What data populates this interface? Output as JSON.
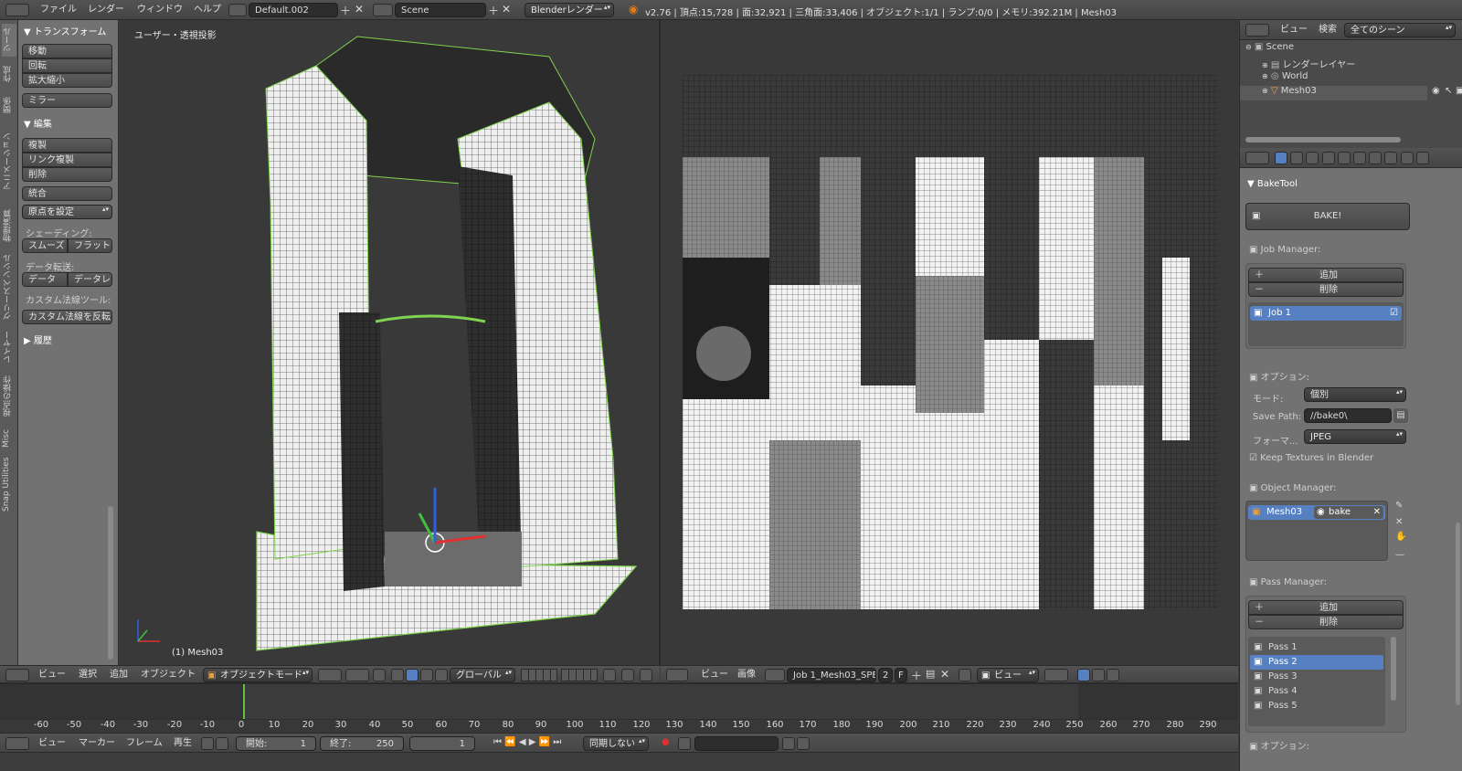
{
  "topbar": {
    "menus": [
      "ファイル",
      "レンダー",
      "ウィンドウ",
      "ヘルプ"
    ],
    "screen_layout": "Default.002",
    "scene": "Scene",
    "render_engine": "Blenderレンダー",
    "stats": "v2.76 | 頂点:15,728 | 面:32,921 | 三角面:33,406 | オブジェクト:1/1 | ランプ:0/0 | メモリ:392.21M | Mesh03"
  },
  "toolshelf": {
    "tabs": [
      "ツール",
      "作成",
      "関係",
      "アニメーション",
      "物理演算",
      "グリースペンシル",
      "レイヤー",
      "視点の操作",
      "Misc",
      "Snap Utilities"
    ],
    "transform_header": "トランスフォーム",
    "transform_buttons": [
      "移動",
      "回転",
      "拡大縮小"
    ],
    "mirror": "ミラー",
    "edit_header": "編集",
    "edit_buttons": [
      "複製",
      "リンク複製",
      "削除"
    ],
    "join": "統合",
    "set_origin": "原点を設定",
    "shading_label": "シェーディング:",
    "shading_smooth": "スムーズ",
    "shading_flat": "フラット",
    "data_transfer_label": "データ転送:",
    "data_btn": "データ",
    "data_layout_btn": "データレ",
    "custom_normals_label": "カスタム法線ツール:",
    "flip_normals": "カスタム法線を反転",
    "history_header": "履歴"
  },
  "viewport": {
    "view_label": "ユーザー・透視投影",
    "object_label": "(1) Mesh03",
    "header_menus": [
      "ビュー",
      "選択",
      "追加",
      "オブジェクト"
    ],
    "mode": "オブジェクトモード",
    "orientation": "グローバル"
  },
  "image_editor": {
    "header_menus": [
      "ビュー",
      "画像"
    ],
    "image_name": "Job 1_Mesh03_SPEC...",
    "users": "2",
    "fake_user": "F",
    "view_mode": "ビュー"
  },
  "outliner": {
    "view_menu": "ビュー",
    "search_menu": "検索",
    "display_mode": "全てのシーン",
    "items": [
      {
        "name": "Scene",
        "level": 0
      },
      {
        "name": "レンダーレイヤー",
        "level": 1
      },
      {
        "name": "World",
        "level": 1
      },
      {
        "name": "Mesh03",
        "level": 1
      }
    ]
  },
  "properties": {
    "panel_title": "BakeTool",
    "bake_button": "BAKE!",
    "job_manager_label": "Job Manager:",
    "add_label": "追加",
    "remove_label": "削除",
    "jobs": [
      "Job 1"
    ],
    "options_label": "オプション:",
    "mode_label": "モード:",
    "mode_value": "個別",
    "save_path_label": "Save Path:",
    "save_path_value": "//bake0\\",
    "format_label": "フォーマ...",
    "format_value": "JPEG",
    "keep_textures_label": "Keep Textures in Blender",
    "object_manager_label": "Object Manager:",
    "object_name": "Mesh03",
    "object_material": "bake",
    "pass_manager_label": "Pass Manager:",
    "passes": [
      "Pass 1",
      "Pass 2",
      "Pass 3",
      "Pass 4",
      "Pass 5"
    ],
    "selected_pass": "Pass 2",
    "options_label2": "オプション:"
  },
  "timeline": {
    "ticks": [
      "-60",
      "-50",
      "-40",
      "-30",
      "-20",
      "-10",
      "0",
      "10",
      "20",
      "30",
      "40",
      "50",
      "60",
      "70",
      "80",
      "90",
      "100",
      "110",
      "120",
      "130",
      "140",
      "150",
      "160",
      "170",
      "180",
      "190",
      "200",
      "210",
      "220",
      "230",
      "240",
      "250",
      "260",
      "270",
      "280",
      "290"
    ],
    "current_frame_marker": "0",
    "header_menus": [
      "ビュー",
      "マーカー",
      "フレーム",
      "再生"
    ],
    "start_label": "開始:",
    "start_value": "1",
    "end_label": "終了:",
    "end_value": "250",
    "current_value": "1",
    "sync": "同期しない"
  },
  "colors": {
    "selection": "#5680c2",
    "viewport_bg": "#393939",
    "panel_bg": "#727272",
    "selected_outline": "#7fd34e"
  }
}
